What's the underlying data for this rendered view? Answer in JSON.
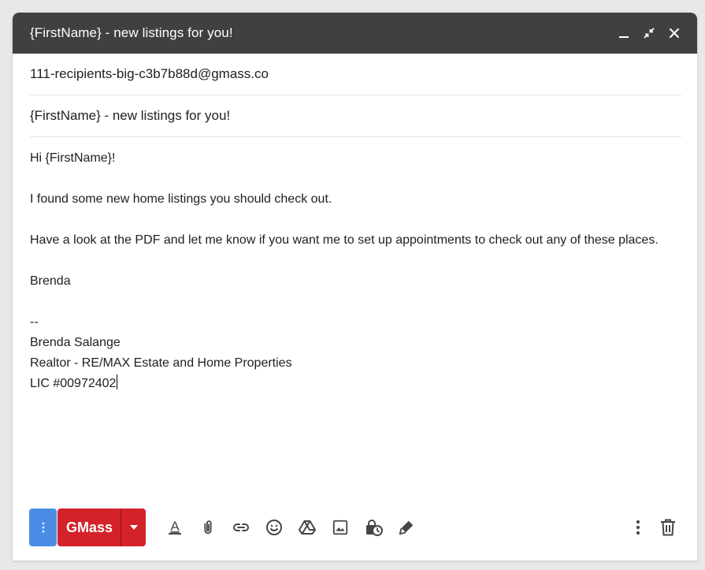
{
  "window": {
    "title": "{FirstName} - new listings for you!",
    "minimize_icon": "minimize-icon",
    "popout_icon": "exit-fullscreen-icon",
    "close_icon": "close-icon"
  },
  "fields": {
    "to": "111-recipients-big-c3b7b88d@gmass.co",
    "subject": "{FirstName} - new listings for you!"
  },
  "body": {
    "greeting": "Hi {FirstName}!",
    "line1": "I found some new home listings you should check out.",
    "line2": "Have a look at the PDF and let me know if you want me to set up appointments to check out any of these places.",
    "closing": "Brenda",
    "sig_separator": "--",
    "sig_name": "Brenda Salange",
    "sig_title": "Realtor - RE/MAX Estate and Home Properties",
    "sig_license": "LIC #00972402"
  },
  "toolbar": {
    "gmass_label": "GMass",
    "icons": [
      "formatting-icon",
      "attach-icon",
      "link-icon",
      "emoji-icon",
      "drive-icon",
      "photo-icon",
      "confidential-icon",
      "signature-icon"
    ],
    "right_icons": [
      "more-options-icon",
      "discard-icon"
    ]
  },
  "colors": {
    "titlebar": "#404040",
    "gmass_red": "#d3222a",
    "more_blue": "#4a8de6",
    "icon_gray": "#444746"
  }
}
